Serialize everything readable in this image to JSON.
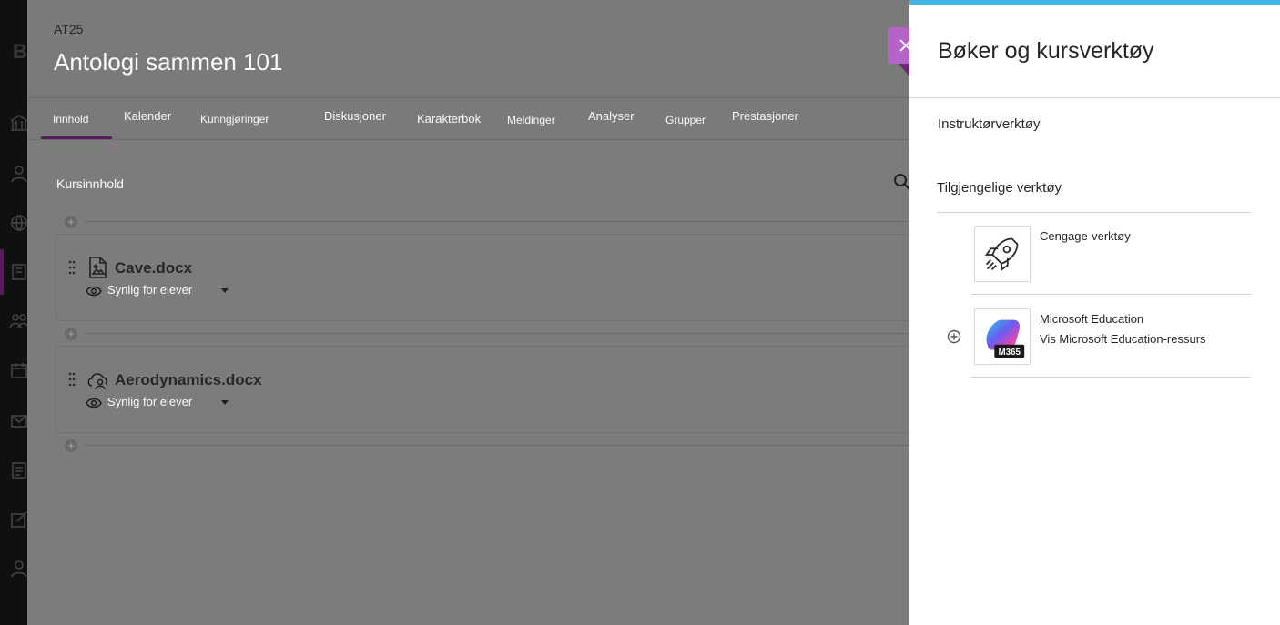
{
  "rail": {
    "logo": "B"
  },
  "course": {
    "code": "AT25",
    "title": "Antologi sammen 101",
    "tabs": [
      {
        "label": "Innhold"
      },
      {
        "label": "Kalender"
      },
      {
        "label": "Kunngjøringer"
      },
      {
        "label": "Diskusjoner"
      },
      {
        "label": "Karakterbok"
      },
      {
        "label": "Meldinger"
      },
      {
        "label": "Analyser"
      },
      {
        "label": "Grupper"
      },
      {
        "label": "Prestasjoner"
      }
    ],
    "active_tab": "Innhold",
    "section_title": "Kursinnhold",
    "items": [
      {
        "name": "Cave.docx",
        "visibility": "Synlig for elever",
        "icon": "document-image-icon"
      },
      {
        "name": "Aerodynamics.docx",
        "visibility": "Synlig for elever",
        "icon": "cloud-person-icon"
      }
    ]
  },
  "panel": {
    "title": "Bøker og kursverktøy",
    "instructor_tools": "Instruktørverktøy",
    "available_tools": "Tilgjengelige verktøy",
    "tools": [
      {
        "name": "Cengage-verktøy",
        "desc": "",
        "icon": "rocket-icon"
      },
      {
        "name": "Microsoft Education",
        "desc": "Vis Microsoft Education-ressurs",
        "icon": "m365-icon",
        "badge": "M365"
      }
    ],
    "accent_color": "#3fb4e5",
    "close_color": "#b463c8"
  }
}
